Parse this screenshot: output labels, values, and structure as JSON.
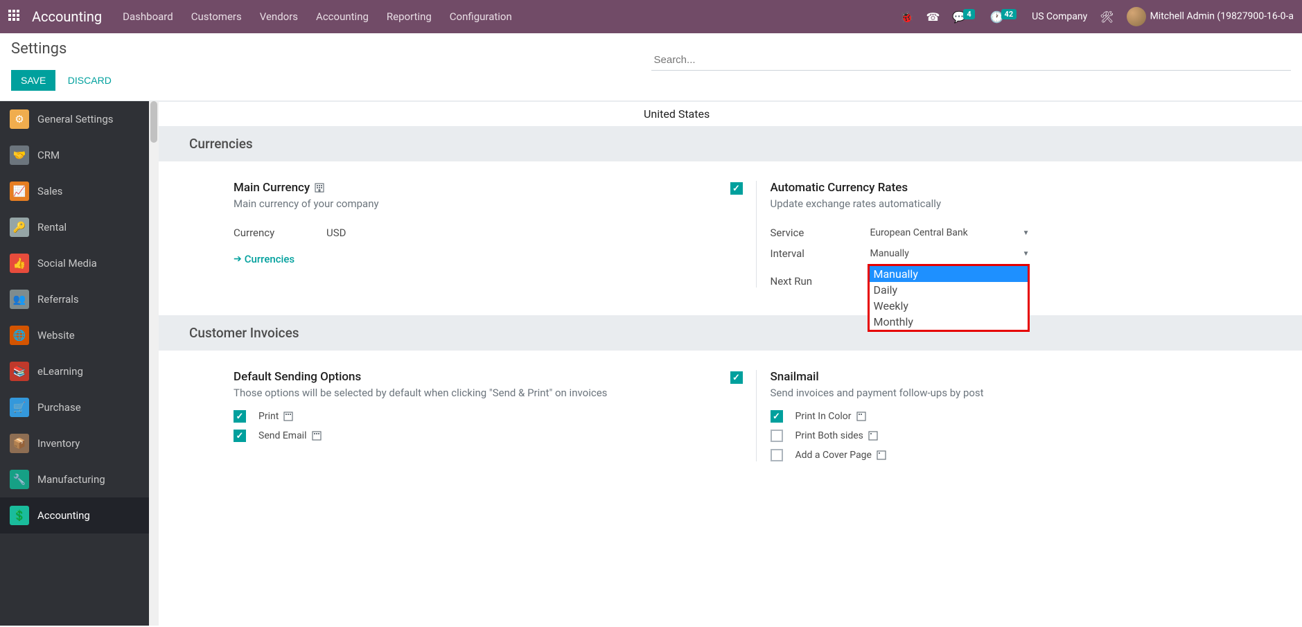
{
  "topbar": {
    "brand": "Accounting",
    "nav": [
      "Dashboard",
      "Customers",
      "Vendors",
      "Accounting",
      "Reporting",
      "Configuration"
    ],
    "badges": {
      "messages": "4",
      "activities": "42"
    },
    "company": "US Company",
    "user": "Mitchell Admin (19827900-16-0-a"
  },
  "control": {
    "title": "Settings",
    "save": "SAVE",
    "discard": "DISCARD",
    "search_placeholder": "Search..."
  },
  "sidebar": [
    {
      "label": "General Settings"
    },
    {
      "label": "CRM"
    },
    {
      "label": "Sales"
    },
    {
      "label": "Rental"
    },
    {
      "label": "Social Media"
    },
    {
      "label": "Referrals"
    },
    {
      "label": "Website"
    },
    {
      "label": "eLearning"
    },
    {
      "label": "Purchase"
    },
    {
      "label": "Inventory"
    },
    {
      "label": "Manufacturing"
    },
    {
      "label": "Accounting"
    }
  ],
  "frag_text": "United States",
  "currencies": {
    "heading": "Currencies",
    "main_currency": {
      "title": "Main Currency",
      "desc": "Main currency of your company",
      "label": "Currency",
      "value": "USD",
      "link": "Currencies"
    },
    "auto_rates": {
      "title": "Automatic Currency Rates",
      "desc": "Update exchange rates automatically",
      "service_label": "Service",
      "service_value": "European Central Bank",
      "interval_label": "Interval",
      "interval_value": "Manually",
      "nextrun_label": "Next Run",
      "options": [
        "Manually",
        "Daily",
        "Weekly",
        "Monthly"
      ]
    }
  },
  "invoices": {
    "heading": "Customer Invoices",
    "sending": {
      "title": "Default Sending Options",
      "desc": "Those options will be selected by default when clicking \"Send & Print\" on invoices",
      "print": "Print",
      "send_email": "Send Email"
    },
    "snailmail": {
      "title": "Snailmail",
      "desc": "Send invoices and payment follow-ups by post",
      "color": "Print In Color",
      "both": "Print Both sides",
      "cover": "Add a Cover Page"
    }
  }
}
